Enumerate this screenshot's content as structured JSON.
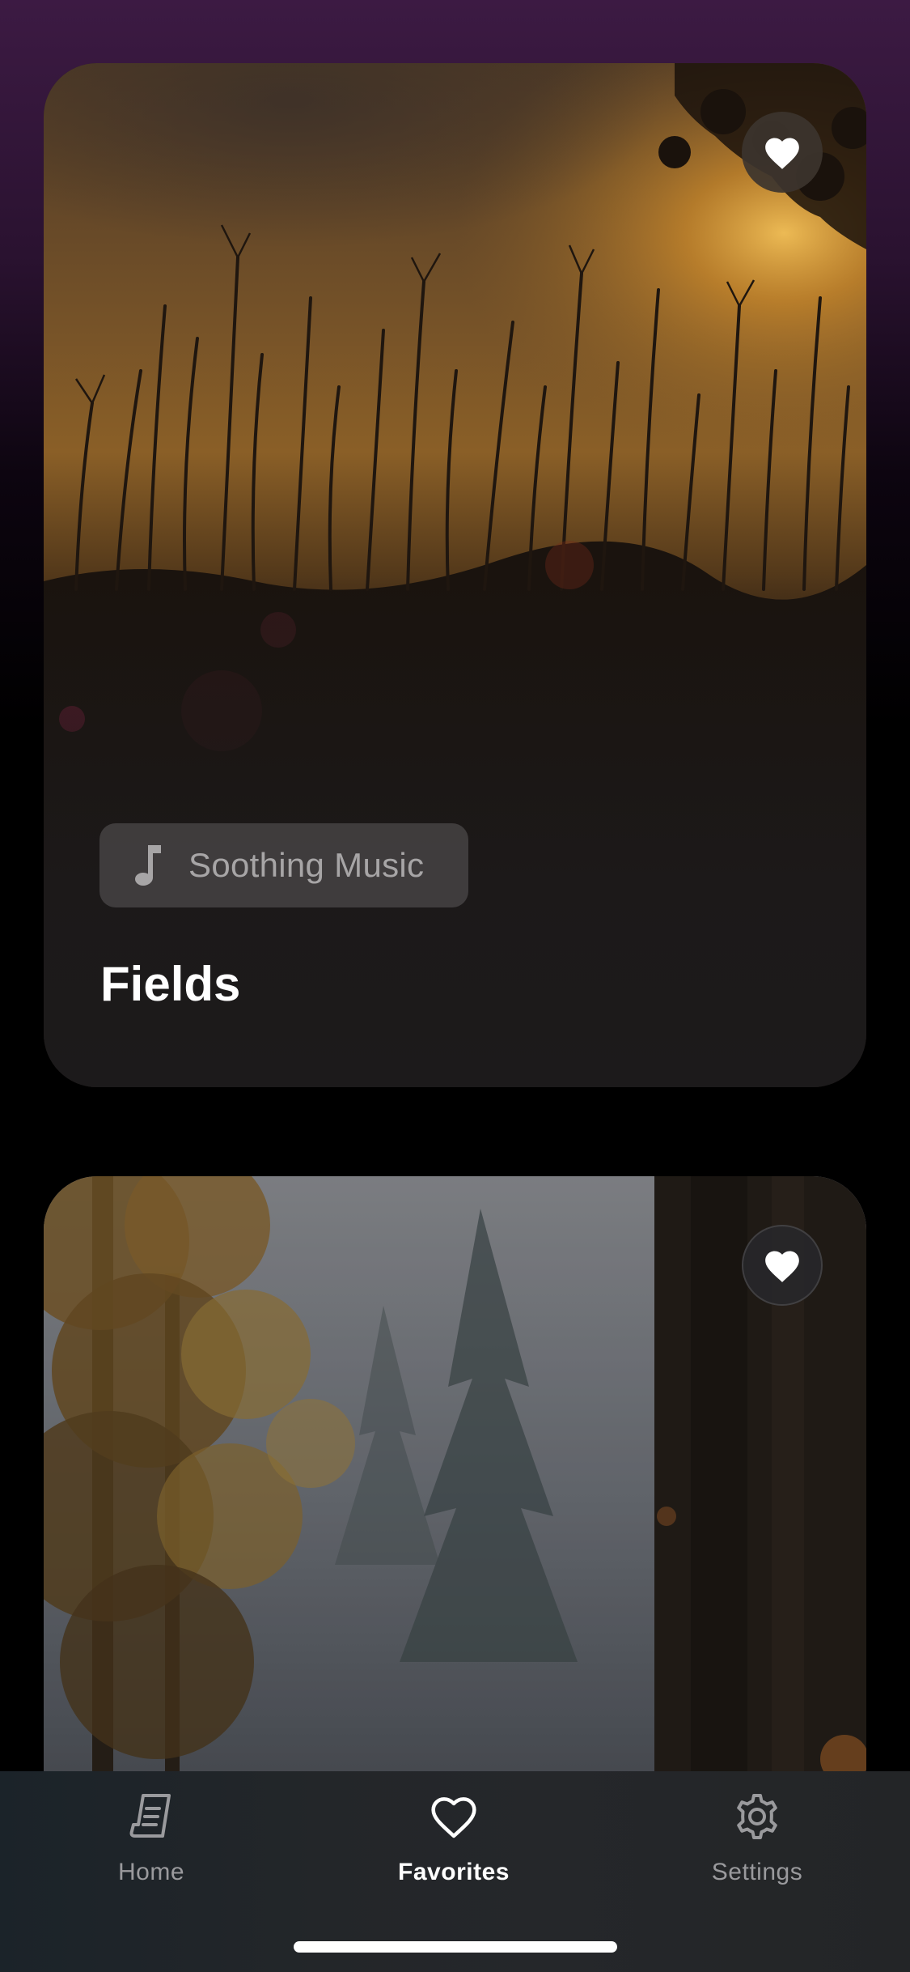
{
  "cards": [
    {
      "title": "Fields",
      "tag": {
        "icon": "music-note-icon",
        "label": "Soothing Music"
      },
      "favorite_icon": "heart-filled-icon"
    },
    {
      "favorite_icon": "heart-filled-icon"
    }
  ],
  "tabbar": {
    "items": [
      {
        "label": "Home",
        "icon": "journal-icon",
        "active": false
      },
      {
        "label": "Favorites",
        "icon": "heart-outline-icon",
        "active": true
      },
      {
        "label": "Settings",
        "icon": "gear-icon",
        "active": false
      }
    ]
  },
  "colors": {
    "header_purple": "#3c1a43",
    "background": "#000000",
    "card_bottom": "#1c1a1b",
    "tab_bar": "#232629",
    "tab_active": "#ffffff",
    "tab_inactive": "#9a9a9d",
    "tag_text": "#a7a5a6"
  }
}
